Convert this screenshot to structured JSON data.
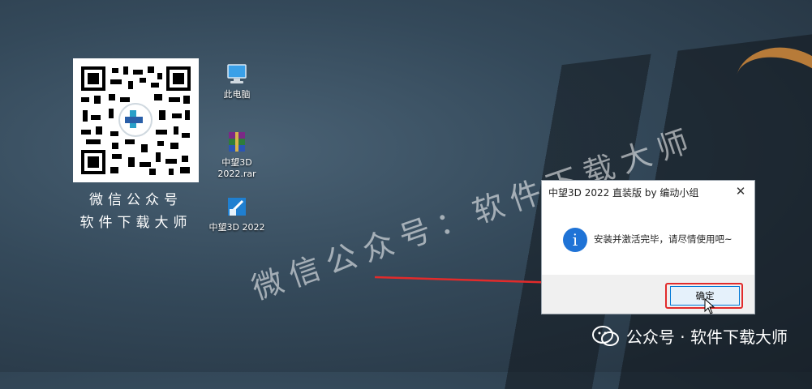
{
  "colors": {
    "accent": "#1f73d6",
    "highlight": "#e22b2b"
  },
  "qr": {
    "caption_line1": "微信公众号",
    "caption_line2": "软件下载大师"
  },
  "desktop_icons": [
    {
      "label": "此电脑",
      "icon": "computer-icon"
    },
    {
      "label": "中望3D 2022.rar",
      "icon": "winrar-archive-icon"
    },
    {
      "label": "中望3D 2022",
      "icon": "zw3d-app-icon"
    }
  ],
  "watermark": {
    "text": "微信公众号：软件下载大师"
  },
  "dialog": {
    "title": "中望3D 2022 直装版 by 编动小组",
    "message": "安装并激活完毕，请尽情使用吧~",
    "ok_label": "确定",
    "close_symbol": "✕"
  },
  "footer": {
    "text": "公众号 · 软件下载大师"
  }
}
